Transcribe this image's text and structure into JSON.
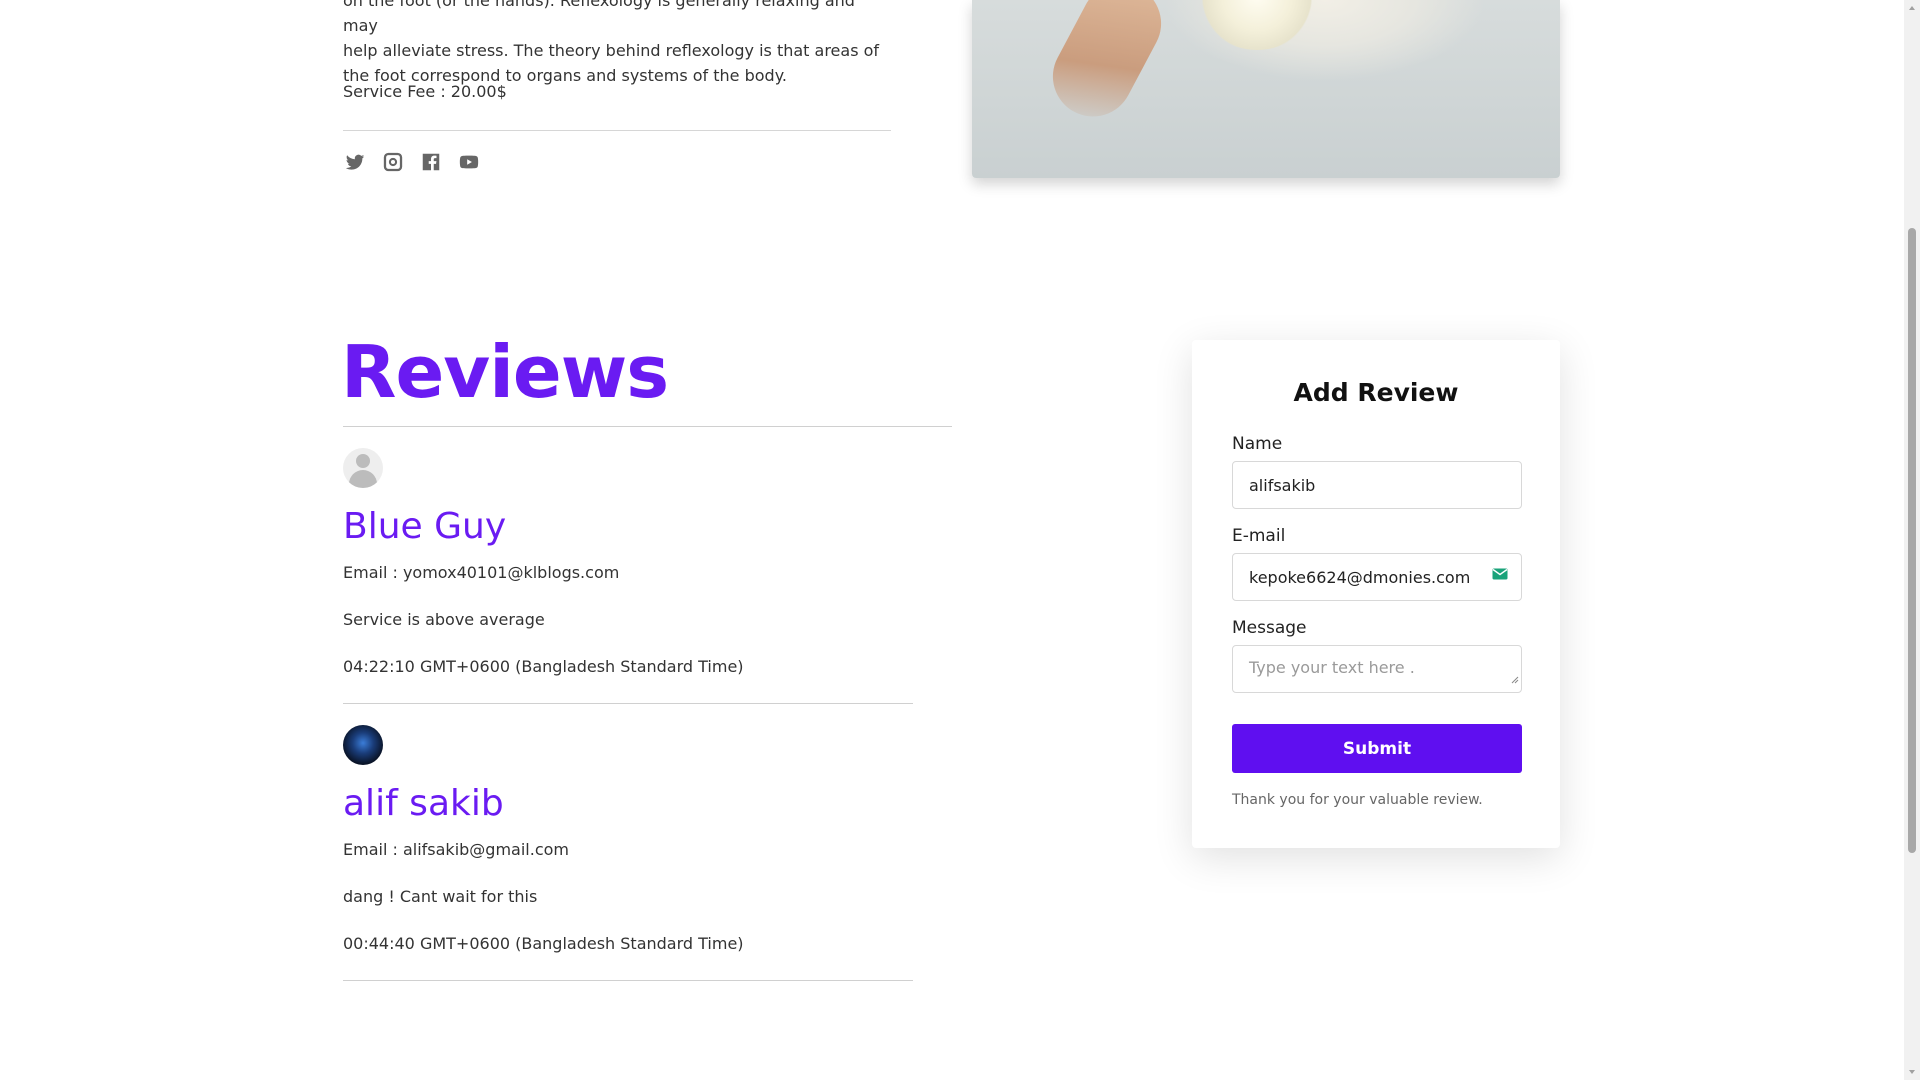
{
  "service": {
    "description_lines": [
      "on the foot (or the hands). Reflexology is generally relaxing and may",
      "help alleviate stress. The theory behind reflexology is that areas of",
      "the foot correspond to organs and systems of the body."
    ],
    "fee_text": "Service Fee : 20.00$",
    "social_icons": [
      "twitter-icon",
      "instagram-icon",
      "facebook-icon",
      "youtube-icon"
    ]
  },
  "reviews": {
    "title": "Reviews",
    "items": [
      {
        "name": "Blue Guy",
        "email_line": "Email : yomox40101@klblogs.com",
        "message": "Service is above average",
        "time": "04:22:10 GMT+0600 (Bangladesh Standard Time)",
        "avatar": "default-user-avatar"
      },
      {
        "name": "alif sakib",
        "email_line": "Email : alifsakib@gmail.com",
        "message": "dang ! Cant wait for this",
        "time": "00:44:40 GMT+0600 (Bangladesh Standard Time)",
        "avatar": "user-photo-avatar"
      }
    ]
  },
  "add_review": {
    "title": "Add Review",
    "name_label": "Name",
    "name_value": "alifsakib",
    "email_label": "E-mail",
    "email_value": "kepoke6624@dmonies.com",
    "message_label": "Message",
    "message_placeholder": "Type your text here .",
    "submit_label": "Submit",
    "thanks_text": "Thank you for your valuable review."
  },
  "colors": {
    "accent": "#6a1bf2",
    "button": "#5f0ff0"
  }
}
